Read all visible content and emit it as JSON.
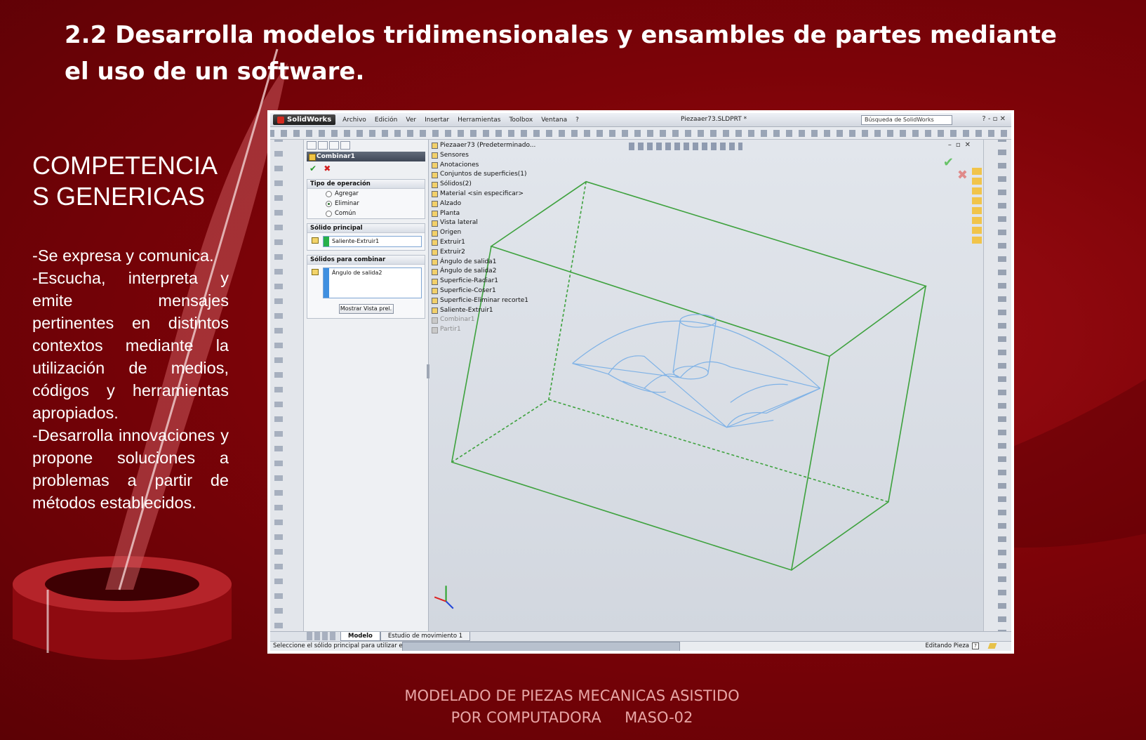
{
  "slide": {
    "title": "2.2 Desarrolla modelos tridimensionales y ensambles de partes mediante el uso de un software.",
    "competencias_title": "COMPETENCIAS GENERICAS",
    "competencias": [
      "-Se expresa y comunica.",
      "-Escucha, interpreta y emite mensajes pertinentes en distintos contextos mediante la utilización de medios, códigos y herramientas apropiados.",
      "-Desarrolla innovaciones y propone soluciones a problemas a partir de métodos establecidos."
    ],
    "footer_line1": "MODELADO DE PIEZAS MECANICAS ASISTIDO",
    "footer_line2": "POR COMPUTADORA     MASO-02"
  },
  "app": {
    "logo": "SolidWorks",
    "menu": [
      "Archivo",
      "Edición",
      "Ver",
      "Insertar",
      "Herramientas",
      "Toolbox",
      "Ventana",
      "?"
    ],
    "doc_title": "Piezaaer73.SLDPRT *",
    "search_placeholder": "Búsqueda de SolidWorks",
    "window_controls": "? - ▫ ✕"
  },
  "property_manager": {
    "feature_name": "Combinar1",
    "operation_group_title": "Tipo de operación",
    "operations": [
      {
        "label": "Agregar",
        "selected": false
      },
      {
        "label": "Eliminar",
        "selected": true
      },
      {
        "label": "Común",
        "selected": false
      }
    ],
    "main_solid_title": "Sólido principal",
    "main_solid_value": "Saliente-Extruir1",
    "combine_solids_title": "Sólidos para combinar",
    "combine_solids_value": "Ángulo de salida2",
    "preview_button": "Mostrar Vista prel."
  },
  "feature_tree": {
    "root": "Piezaaer73  (Predeterminado...",
    "items": [
      {
        "label": "Sensores",
        "gray": false
      },
      {
        "label": "Anotaciones",
        "gray": false
      },
      {
        "label": "Conjuntos de superficies(1)",
        "gray": false
      },
      {
        "label": "Sólidos(2)",
        "gray": false
      },
      {
        "label": "Material <sin especificar>",
        "gray": false
      },
      {
        "label": "Alzado",
        "gray": false
      },
      {
        "label": "Planta",
        "gray": false
      },
      {
        "label": "Vista lateral",
        "gray": false
      },
      {
        "label": "Origen",
        "gray": false
      },
      {
        "label": "Extruir1",
        "gray": false
      },
      {
        "label": "Extruir2",
        "gray": false
      },
      {
        "label": "Ángulo de salida1",
        "gray": false
      },
      {
        "label": "Ángulo de salida2",
        "gray": false
      },
      {
        "label": "Superficie-Radiar1",
        "gray": false
      },
      {
        "label": "Superficie-Coser1",
        "gray": false
      },
      {
        "label": "Superficie-Eliminar recorte1",
        "gray": false
      },
      {
        "label": "Saliente-Extruir1",
        "gray": false
      },
      {
        "label": "Combinar1",
        "gray": true
      },
      {
        "label": "Partir1",
        "gray": true
      }
    ]
  },
  "tabs": [
    "Modelo",
    "Estudio de movimiento 1"
  ],
  "status": {
    "left": "Seleccione el sólido principal para utilizar en la op",
    "right": "Editando Pieza"
  },
  "colors": {
    "background": "#7d0308",
    "box_edges": "#3fa23f",
    "part_edges": "#7fb2e6"
  }
}
